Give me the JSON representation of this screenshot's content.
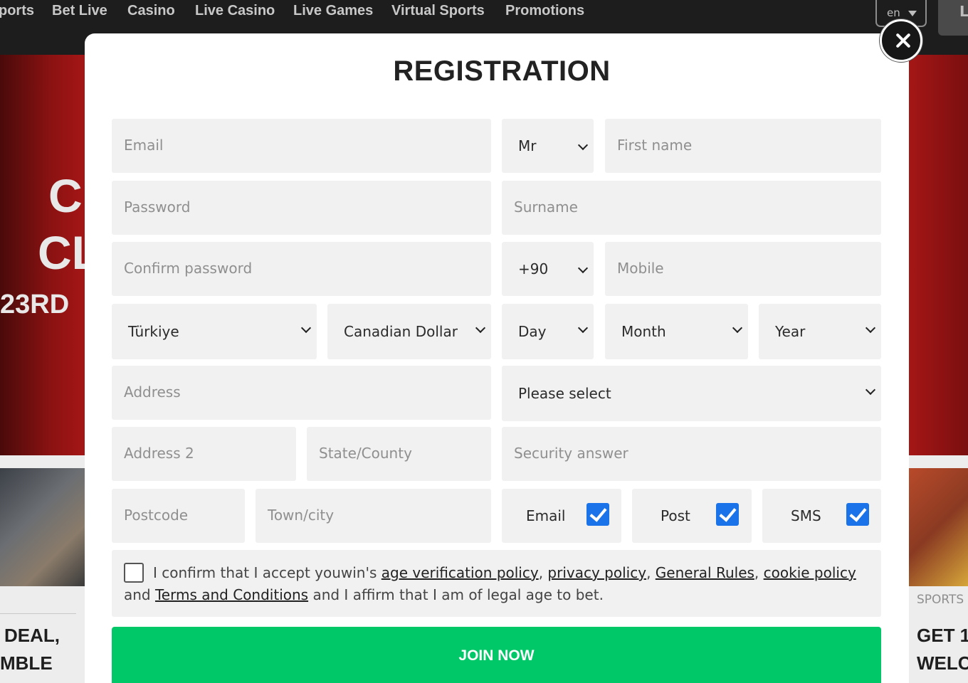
{
  "nav": {
    "items": [
      {
        "label": "Sports",
        "visible": "ports"
      },
      {
        "label": "Bet Live"
      },
      {
        "label": "Casino"
      },
      {
        "label": "Live Casino"
      },
      {
        "label": "Live Games"
      },
      {
        "label": "Virtual Sports"
      },
      {
        "label": "Promotions"
      }
    ],
    "lang": "en",
    "login_partial": "L"
  },
  "background": {
    "hero_line1": "C",
    "hero_line2": "CL",
    "hero_line3": "23RD",
    "promo_left_line1": "DEAL,",
    "promo_left_line2": "MBLE",
    "sports_label": "SPORTS",
    "promo_right_line1": "GET 1",
    "promo_right_line2": "WELC"
  },
  "modal": {
    "title": "REGISTRATION",
    "fields": {
      "email": "Email",
      "title_select": "Mr",
      "first_name": "First name",
      "password": "Password",
      "surname": "Surname",
      "confirm_password": "Confirm password",
      "phone_code": "+90",
      "mobile": "Mobile",
      "country": "Türkiye",
      "currency": "Canadian Dollar",
      "day": "Day",
      "month": "Month",
      "year": "Year",
      "address": "Address",
      "security_question": "Please select",
      "address2": "Address 2",
      "state": "State/County",
      "security_answer": "Security answer",
      "postcode": "Postcode",
      "town": "Town/city"
    },
    "contact_prefs": {
      "email": "Email",
      "post": "Post",
      "sms": "SMS"
    },
    "terms": {
      "part1": "I confirm that I accept youwin's ",
      "link_age": "age verification policy",
      "sep1": ", ",
      "link_privacy": "privacy policy",
      "sep2": ", ",
      "link_rules": "General Rules",
      "sep3": ", ",
      "link_cookie": "cookie policy",
      "part2": " and ",
      "link_terms": "Terms and Conditions",
      "part3": " and I affirm that I am of legal age to bet."
    },
    "join_label": "JOIN NOW"
  },
  "colors": {
    "join_green": "#00c767",
    "checkbox_blue": "#1a73e8",
    "field_bg": "#f1f1f1"
  }
}
